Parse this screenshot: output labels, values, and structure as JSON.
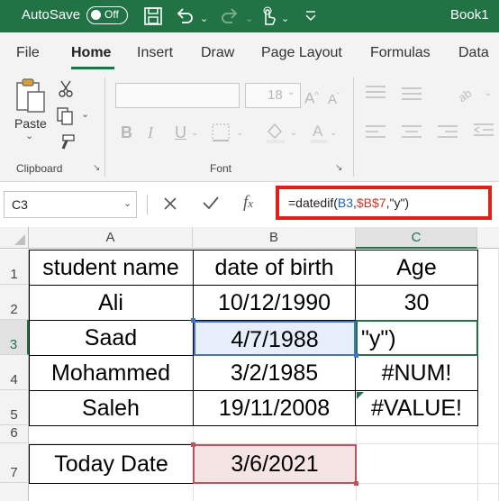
{
  "titlebar": {
    "autosave_label": "AutoSave",
    "autosave_state": "Off",
    "book_title": "Book1",
    "color": "#217346"
  },
  "tabs": [
    {
      "label": "File",
      "active": false
    },
    {
      "label": "Home",
      "active": true
    },
    {
      "label": "Insert",
      "active": false
    },
    {
      "label": "Draw",
      "active": false
    },
    {
      "label": "Page Layout",
      "active": false
    },
    {
      "label": "Formulas",
      "active": false
    },
    {
      "label": "Data",
      "active": false
    }
  ],
  "ribbon": {
    "clipboard": {
      "paste_label": "Paste",
      "group_label": "Clipboard"
    },
    "font": {
      "size_value": "18",
      "group_label": "Font",
      "bold": "B",
      "italic": "I",
      "underline": "U"
    }
  },
  "formula_bar": {
    "name_box": "C3",
    "formula_prefix": "=datedif(",
    "formula_ref1": "B3",
    "formula_sep1": ",",
    "formula_ref2": "$B$7",
    "formula_suffix": ",\"y\")",
    "highlight_color": "#e0201f"
  },
  "sheet": {
    "columns": [
      "A",
      "B",
      "C"
    ],
    "selected_column": "C",
    "rows": [
      "1",
      "2",
      "3",
      "4",
      "5",
      "6",
      "7"
    ],
    "selected_row": "3",
    "headers": {
      "a": "student name",
      "b": "date of birth",
      "c": "Age"
    },
    "data": [
      {
        "name": "Ali",
        "dob": "10/12/1990",
        "age": "30"
      },
      {
        "name": "Saad",
        "dob": "4/7/1988",
        "age": "\"y\")"
      },
      {
        "name": "Mohammed",
        "dob": "3/2/1985",
        "age": "#NUM!"
      },
      {
        "name": "Saleh",
        "dob": "19/11/2008",
        "age": "#VALUE!"
      }
    ],
    "today_label": "Today Date",
    "today_value": "3/6/2021",
    "ref_blue": "#1f5fc1",
    "ref_red": "#c0392b"
  }
}
